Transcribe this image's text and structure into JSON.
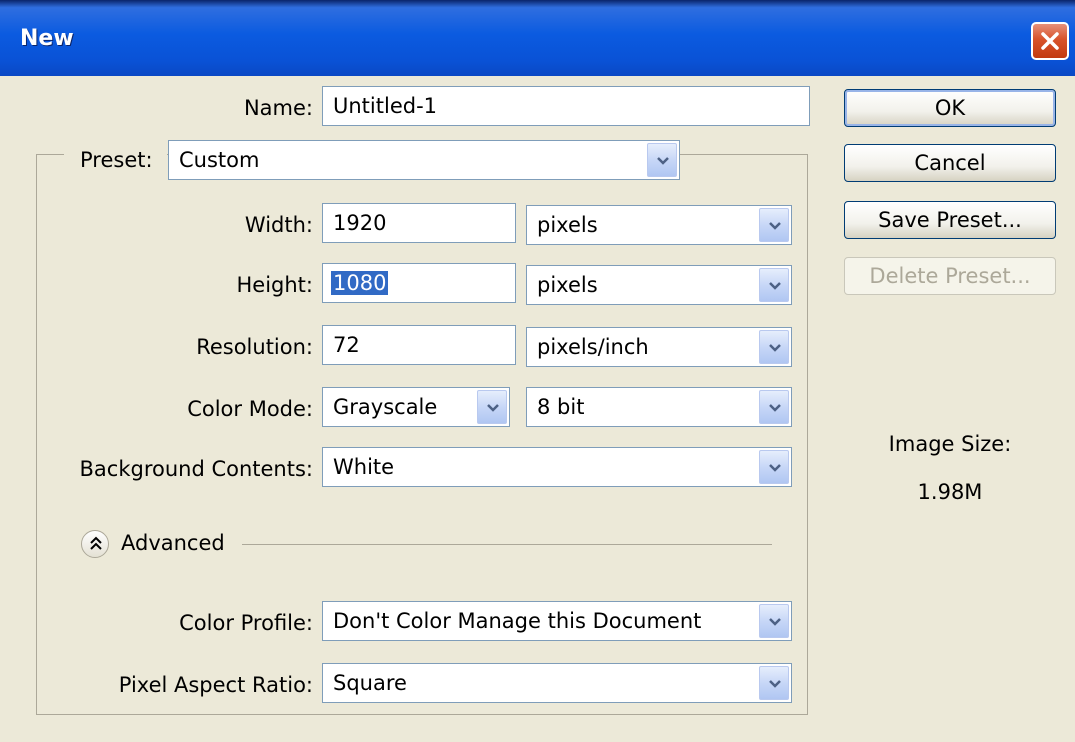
{
  "window": {
    "title": "New"
  },
  "form": {
    "name": {
      "label": "Name:",
      "value": "Untitled-1"
    },
    "preset": {
      "label": "Preset:",
      "value": "Custom"
    },
    "width": {
      "label": "Width:",
      "value": "1920",
      "unit": "pixels"
    },
    "height": {
      "label": "Height:",
      "value": "1080",
      "unit": "pixels"
    },
    "resolution": {
      "label": "Resolution:",
      "value": "72",
      "unit": "pixels/inch"
    },
    "color_mode": {
      "label": "Color Mode:",
      "value": "Grayscale",
      "depth": "8 bit"
    },
    "background_contents": {
      "label": "Background Contents:",
      "value": "White"
    },
    "advanced": {
      "label": "Advanced"
    },
    "color_profile": {
      "label": "Color Profile:",
      "value": "Don't Color Manage this Document"
    },
    "pixel_aspect_ratio": {
      "label": "Pixel Aspect Ratio:",
      "value": "Square"
    }
  },
  "buttons": {
    "ok": "OK",
    "cancel": "Cancel",
    "save_preset": "Save Preset...",
    "delete_preset": "Delete Preset..."
  },
  "image_size": {
    "label": "Image Size:",
    "value": "1.98M"
  },
  "colors": {
    "titlebar": "#0a52d6",
    "dialog_bg": "#ece9d8",
    "field_border": "#7f9db9",
    "selection": "#316ac5"
  },
  "icons": {
    "close": "close-icon",
    "dropdown": "chevron-down-icon",
    "advanced_toggle": "double-chevron-up-icon"
  }
}
